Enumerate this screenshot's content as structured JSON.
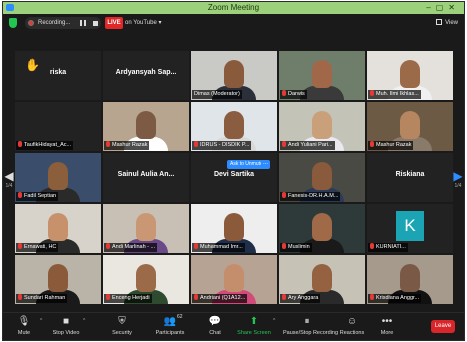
{
  "window": {
    "title": "Zoom Meeting"
  },
  "topbar": {
    "recording_label": "Recording...",
    "live_label": "LIVE",
    "live_destination": "on YouTube",
    "view_label": "View"
  },
  "participants": [
    {
      "label": "riska",
      "kind": "name",
      "raised_hand": true
    },
    {
      "label": "Ardyansyah Sap...",
      "kind": "name"
    },
    {
      "label": "Dimas (Moderator)",
      "kind": "video",
      "active_speaker": true,
      "bg": "#c9c9c5",
      "skin": "#8a5a3c",
      "shirt": "#2b2f3a"
    },
    {
      "label": "Darwis",
      "kind": "video",
      "muted": true,
      "bg": "#6f7e6a",
      "skin": "#a06848",
      "shirt": "#3a3a3a"
    },
    {
      "label": "Muh. Ilmi Ikhlas...",
      "kind": "video",
      "muted": true,
      "bg": "#e4e1dc",
      "skin": "#9b6a48",
      "shirt": "#f0f0f0"
    },
    {
      "label": "TaufikHidayat_Ac...",
      "kind": "empty",
      "muted": true
    },
    {
      "label": "Mashur Razak",
      "kind": "video",
      "muted": true,
      "bg": "#b7a58f",
      "skin": "#7d5a44",
      "shirt": "#ffffff"
    },
    {
      "label": "IDRUS - DISDIK P...",
      "kind": "video",
      "muted": true,
      "bg": "#dfe5e8",
      "skin": "#8a5c40",
      "shirt": "#d8d8d8"
    },
    {
      "label": "Andi Yuliani Pari...",
      "kind": "video",
      "muted": true,
      "bg": "#c4c3b8",
      "skin": "#c9a07a",
      "shirt": "#e9e9ee"
    },
    {
      "label": "Mashur Razak",
      "kind": "video",
      "muted": true,
      "bg": "#6d5a45",
      "skin": "#b58660",
      "shirt": "#8a7a6a"
    },
    {
      "label": "Fadil Septian",
      "kind": "video",
      "muted": true,
      "bg": "#3a4d6a",
      "skin": "#8b5e3c",
      "shirt": "#2a2a2a"
    },
    {
      "label": "Sainul Aulia An...",
      "kind": "name"
    },
    {
      "label": "Devi Sartika",
      "kind": "name",
      "unmute_request": true,
      "unmute_label": "Ask to Unmute",
      "more_label": "..."
    },
    {
      "label": "Fanesis-DR.H.A.M...",
      "kind": "video",
      "muted": true,
      "bg": "#4a4a44",
      "skin": "#8a5a3c",
      "shirt": "#2b3a55"
    },
    {
      "label": "Riskiana",
      "kind": "name"
    },
    {
      "label": "Ernawati, HC",
      "kind": "video",
      "muted": true,
      "bg": "#d7d3cb",
      "skin": "#c6916b",
      "shirt": "#2a2a2a"
    },
    {
      "label": "Andi Marlinah - ...",
      "kind": "video",
      "muted": true,
      "bg": "#c8c0b4",
      "skin": "#c99773",
      "shirt": "#6b4a8a"
    },
    {
      "label": "Muhammad Imr...",
      "kind": "video",
      "muted": true,
      "bg": "#eeeeee",
      "skin": "#8b5a3a",
      "shirt": "#1f2f4a"
    },
    {
      "label": "Muslimin",
      "kind": "video",
      "muted": true,
      "bg": "#2e3a3a",
      "skin": "#a06a48",
      "shirt": "#1a1a1a"
    },
    {
      "label": "KURNIATI...",
      "kind": "avatar",
      "initial": "K",
      "muted": true
    },
    {
      "label": "Sundari Rahman",
      "kind": "video",
      "muted": true,
      "bg": "#b9b3a8",
      "skin": "#8a5a3a",
      "shirt": "#1a1a1a"
    },
    {
      "label": "Enceng Herjadi",
      "kind": "video",
      "muted": true,
      "bg": "#e9e7e0",
      "skin": "#9b6a48",
      "shirt": "#2f4b2f"
    },
    {
      "label": "Andriani (Q1A12...",
      "kind": "video",
      "muted": true,
      "bg": "#b7a394",
      "skin": "#c48d6c",
      "shirt": "#d04a7a"
    },
    {
      "label": "Ary Anggara",
      "kind": "video",
      "muted": true,
      "bg": "#c7c2b6",
      "skin": "#946241",
      "shirt": "#2a2a2a"
    },
    {
      "label": "Krisdiana Anggr...",
      "kind": "video",
      "muted": true,
      "bg": "#a59a8c",
      "skin": "#7a5a46",
      "shirt": "#111111"
    }
  ],
  "pagination": {
    "left_page": "1/4",
    "right_page": "1/4"
  },
  "toolbar": {
    "mute": "Mute",
    "stop_video": "Stop Video",
    "security": "Security",
    "participants": "Participants",
    "participant_count": "62",
    "chat": "Chat",
    "share_screen": "Share Screen",
    "pause_recording": "Pause/Stop Recording",
    "reactions": "Reactions",
    "more": "More",
    "leave": "Leave"
  },
  "colors": {
    "titlebar": "#9cd07a",
    "active_speaker": "#a6e86a",
    "live": "#e02828",
    "leave": "#d8262a",
    "share": "#23c552",
    "accent": "#2d8cff"
  },
  "icons": {
    "mute": "microphone-icon",
    "stop_video": "video-camera-icon",
    "security": "shield-icon",
    "participants": "people-icon",
    "chat": "chat-bubble-icon",
    "share_screen": "share-arrow-icon",
    "pause_recording": "pause-icon",
    "reactions": "smiley-icon",
    "more": "ellipsis-icon"
  }
}
